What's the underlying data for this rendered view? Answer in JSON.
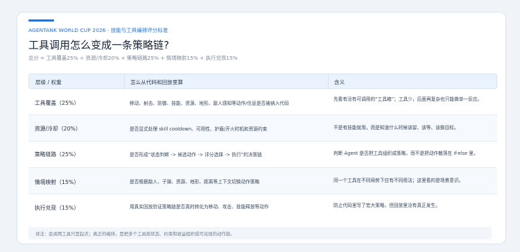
{
  "header": {
    "kicker": "AGENTANK WORLD CUP 2026 · 技能与工具编排评分标准",
    "title": "工具调用怎么变成一条策略链?",
    "subtitle": "总分 = 工具覆盖25% + 资源/冷却20% + 策略链路25% + 情境映射15% + 执行兑现15%"
  },
  "table": {
    "columns": [
      "层级 / 权重",
      "怎么从代码和回放里算",
      "含义"
    ],
    "rows": [
      {
        "level": "工具覆盖（25%）",
        "how": "移动、射击、防御、技能、资源、地形、敌人感知等动作/信息是否被纳入代码",
        "meaning": "先看有没有可调用的“工具箱”；工具少，后面再复杂也只能做单一反应。"
      },
      {
        "level": "资源/冷却（20%）",
        "how": "是否显式处理 skill cooldown、可用性、护盾/开火时机和资源约束",
        "meaning": "不是有技能就用，而是知道什么时候该留、该等、该换目标。"
      },
      {
        "level": "策略链路（25%）",
        "how": "是否形成“状态判断 -> 候选动作 -> 评分选择 -> 执行”的决策链",
        "meaning": "判断 Agent 是否把工具组织成策略，而不是把动作散落在 if-else 里。"
      },
      {
        "level": "情境映射（15%）",
        "how": "是否根据敌人、子弹、资源、地形、距离等上下文切换动作策略",
        "meaning": "同一个工具在不同局势下应有不同用法；这里看的是场景意识。"
      },
      {
        "level": "执行兑现（15%）",
        "how": "用真实回放验证策略链是否真的转化为移动、攻击、技能释放等动作",
        "meaning": "防止代码里写了宏大策略，但回放里没有真正发生。"
      }
    ]
  },
  "note": "读法：会调用工具只是起点；真正的编排，是把多个工具按状态、约束和收益组织成可兑现的动作链。",
  "colors": {
    "accent": "#1e73e0",
    "header_bg": "#eaf3fd",
    "border": "#d6e4f2"
  }
}
